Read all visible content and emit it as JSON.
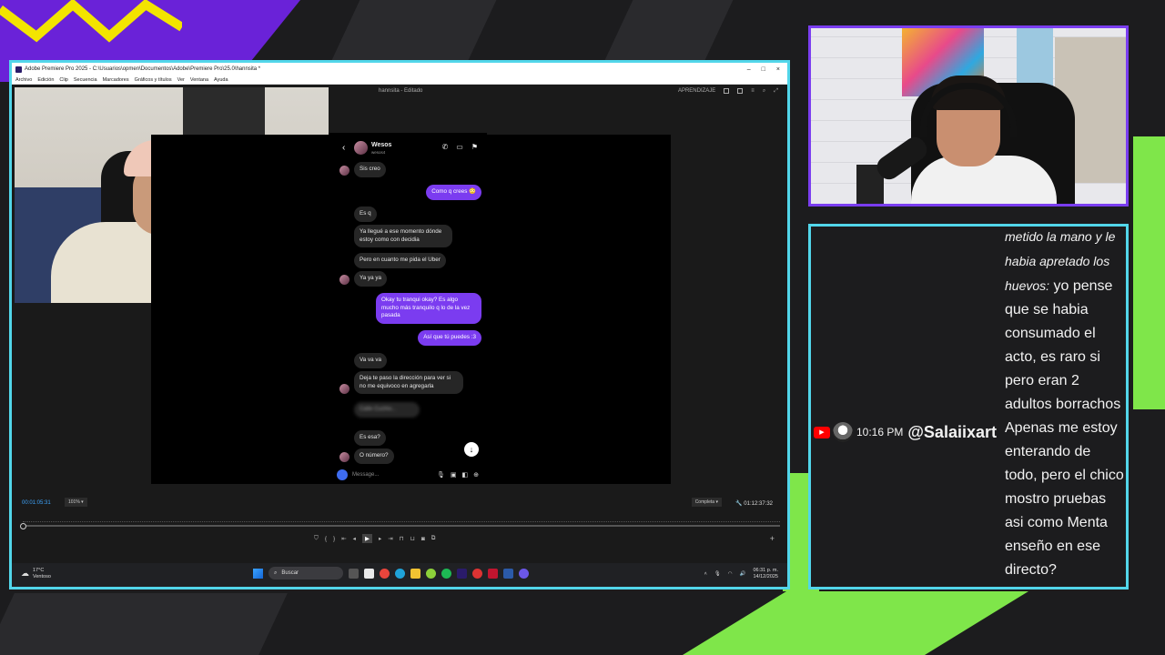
{
  "colors": {
    "frame_cyan": "#52d6ea",
    "frame_purple": "#7a3df0",
    "accent_green": "#7fe64a",
    "ig_outgoing": "#7b3cf0",
    "timecode_blue": "#3ea6ff",
    "youtube_red": "#ff0000"
  },
  "premiere": {
    "window_title": "Adobe Premiere Pro 2025 - C:\\Usuarios\\opmen\\Documentos\\Adobe\\Premiere Pro\\25.0\\hannsita *",
    "window_controls": [
      "–",
      "□",
      "×"
    ],
    "menu": [
      "Archivo",
      "Edición",
      "Clip",
      "Secuencia",
      "Marcadores",
      "Gráficos y títulos",
      "Ver",
      "Ventana",
      "Ayuda"
    ],
    "project_name": "hannsita",
    "project_status": "Editado",
    "workspace_label": "APRENDIZAJE",
    "timecode_current": "00:01:05:31",
    "zoom": "101%",
    "quality": "Completa",
    "timecode_total": "01:12:37:32"
  },
  "instagram": {
    "contact_name": "Wesos",
    "contact_handle": "wesos4",
    "messages": [
      {
        "dir": "in",
        "text": "Sis creo"
      },
      {
        "dir": "out",
        "text": "Como q crees 😳"
      },
      {
        "dir": "in",
        "text": "Es q"
      },
      {
        "dir": "in",
        "text": "Ya llegué a ese momento dónde estoy como con decidia"
      },
      {
        "dir": "in",
        "text": "Pero en cuanto me pida el Uber"
      },
      {
        "dir": "in",
        "text": "Ya ya ya"
      },
      {
        "dir": "out",
        "text": "Okay tu tranqui okay? Es algo mucho más tranquilo q lo de la vez pasada"
      },
      {
        "dir": "out",
        "text": "Así que tú puedes :3"
      },
      {
        "dir": "in",
        "text": "Va va va"
      },
      {
        "dir": "in",
        "text": "Deja te paso la dirección para ver si no me equivoco en agregarla"
      },
      {
        "dir": "in",
        "text": "Calle Cuchiv..."
      },
      {
        "dir": "in",
        "text": "Es esa?"
      },
      {
        "dir": "in",
        "text": "O número?"
      }
    ],
    "input_placeholder": "Message..."
  },
  "taskbar": {
    "weather_temp": "17°C",
    "weather_desc": "Ventoso",
    "search_label": "Buscar",
    "time": "06:31 p. m.",
    "date": "14/12/2025"
  },
  "chat": {
    "prev_line_1": "metido la mano y le",
    "prev_line_2": "habia apretado los",
    "prev_line_3": "huevos:",
    "prev_rest": "yo pense que se habia consumado el acto, es raro si pero eran 2 adultos borrachos",
    "time": "10:16 PM",
    "username": "@Salaiixart",
    "message": "Apenas me estoy enterando de todo, pero el chico mostro pruebas asi como Menta enseño en ese directo?"
  }
}
